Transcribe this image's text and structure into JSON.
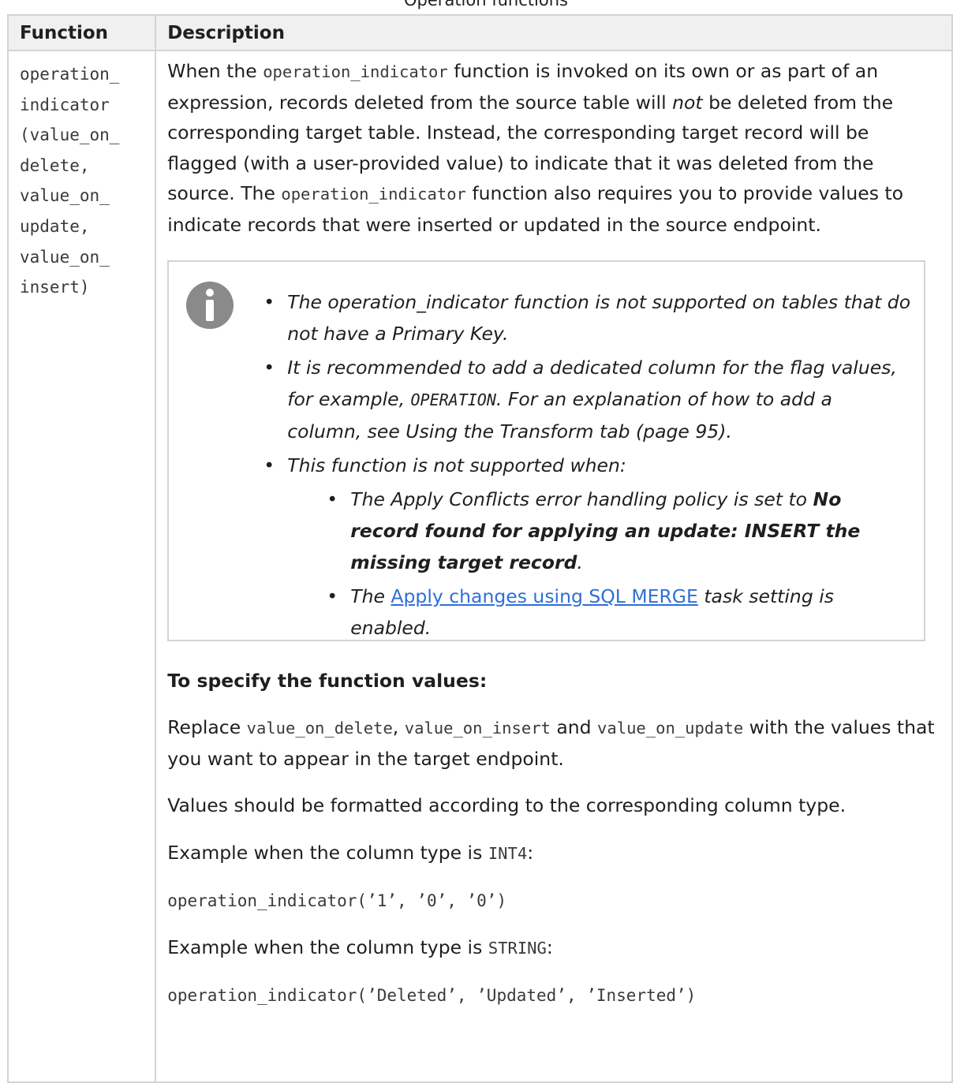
{
  "caption": "Operation functions",
  "headers": {
    "function": "Function",
    "description": "Description"
  },
  "function_lines": [
    "operation_",
    "indicator",
    "(value_on_",
    "delete,",
    "value_on_",
    "update,",
    "value_on_",
    "insert)"
  ],
  "intro": {
    "t1": "When the ",
    "code1": "operation_indicator",
    "t2": " function is invoked on its own or as part of an expression, records deleted from the source table will ",
    "em": "not",
    "t3": " be deleted from the corresponding target table. Instead, the corresponding target record will be flagged (with a user-provided value) to indicate that it was deleted from the source. The ",
    "code2": "operation_indicator",
    "t4": " function also requires you to provide values to indicate records that were inserted or updated in the source endpoint."
  },
  "note": {
    "icon": "info-icon",
    "bullet1": "The operation_indicator function is not supported on tables that do not have a Primary Key.",
    "bullet2_a": "It is recommended to add a dedicated column for the flag values, for example, ",
    "bullet2_code": "OPERATION",
    "bullet2_b": ". For an explanation of how to add a column, see Using the Transform tab (page 95).",
    "bullet3": "This function is not supported when:",
    "sub1_a": "The Apply Conflicts error handling policy is set to ",
    "sub1_bold": "No record found for applying an update: INSERT the missing target record",
    "sub1_b": ".",
    "sub2_a": "The ",
    "sub2_link": "Apply changes using SQL MERGE",
    "sub2_b": " task setting is enabled."
  },
  "specify_heading": "To specify the function values:",
  "replace": {
    "t1": "Replace ",
    "c1": "value_on_delete",
    "t2": ", ",
    "c2": "value_on_insert",
    "t3": " and ",
    "c3": "value_on_update",
    "t4": " with the values that you want to appear in the target endpoint."
  },
  "format_note": "Values should be formatted according to the corresponding column type.",
  "example1": {
    "t": "Example when the column type is ",
    "c": "INT4",
    "end": ":"
  },
  "code1": "operation_indicator(’1’, ’0’, ’0’)",
  "example2": {
    "t": "Example when the column type is ",
    "c": "STRING",
    "end": ":"
  },
  "code2": "operation_indicator(’Deleted’, ’Updated’, ’Inserted’)",
  "colors": {
    "border": "#d4d4d4",
    "header_bg": "#f0f0f0",
    "link": "#2e6fd8",
    "icon": "#8a8a8a"
  }
}
